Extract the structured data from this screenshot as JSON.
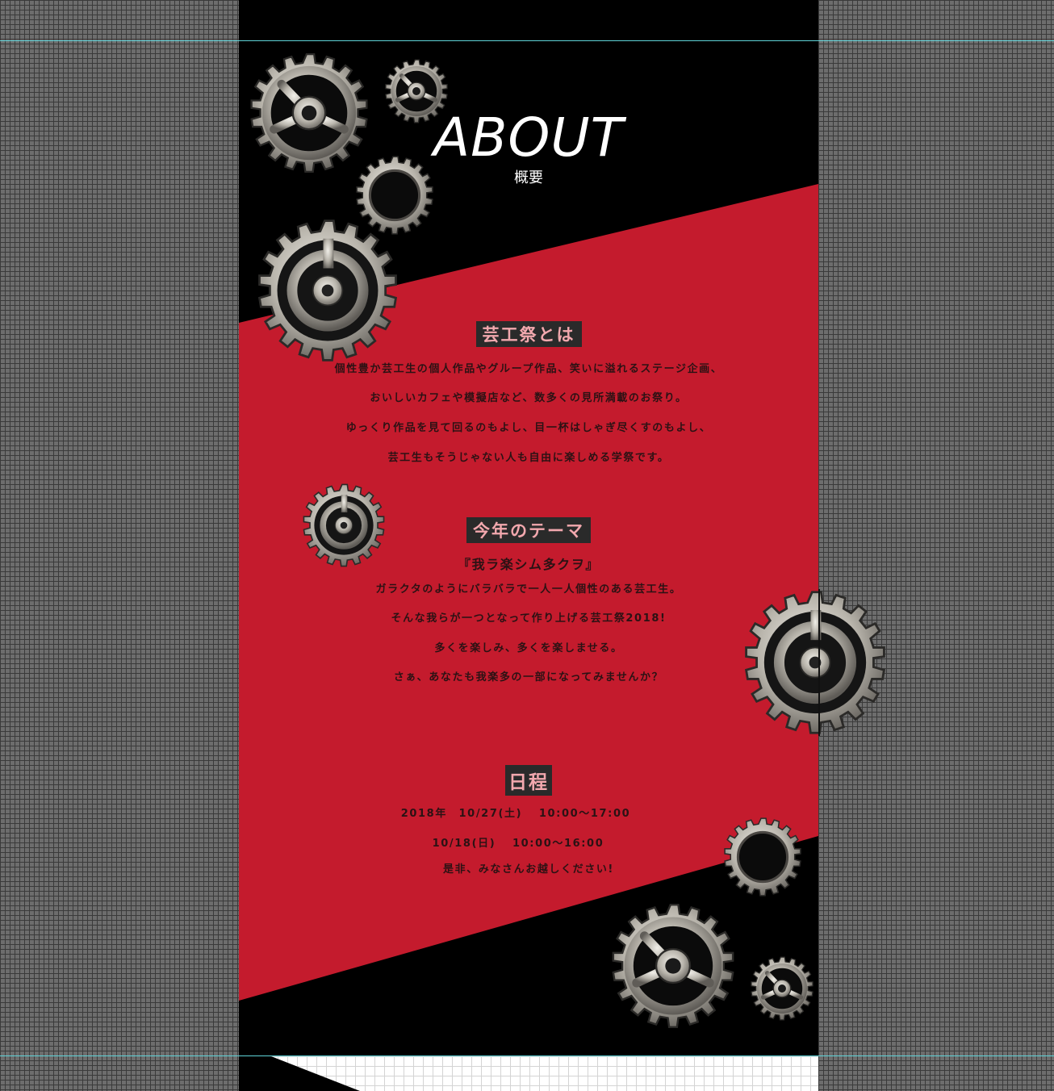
{
  "page": {
    "title": "ABOUT",
    "subtitle": "概要",
    "colors": {
      "red": "#c41b2d",
      "black": "#000000",
      "guide": "#5fd3d8"
    }
  },
  "sections": {
    "geikosai": {
      "heading": "芸工祭とは",
      "lines": [
        "個性豊か芸工生の個人作品やグループ作品、笑いに溢れるステージ企画、",
        "おいしいカフェや模擬店など、数多くの見所満載のお祭り。",
        "ゆっくり作品を見て回るのもよし、目一杯はしゃぎ尽くすのもよし、",
        "芸工生もそうじゃない人も自由に楽しめる学祭です。"
      ]
    },
    "theme": {
      "heading": "今年のテーマ",
      "title": "『我ラ楽シム多クヲ』",
      "lines": [
        "ガラクタのようにバラバラで一人一人個性のある芸工生。",
        "そんな我らが一つとなって作り上げる芸工祭2018!",
        "多くを楽しみ、多くを楽しませる。",
        "さぁ、あなたも我楽多の一部になってみませんか？"
      ]
    },
    "schedule": {
      "heading": "日程",
      "line1": "2018年　10/27(土)　 10:00～17:00",
      "line2": "10/18(日)　 10:00～16:00",
      "closing": "是非、みなさんお越しください!"
    }
  },
  "icons": {
    "gear": "gear-icon"
  }
}
